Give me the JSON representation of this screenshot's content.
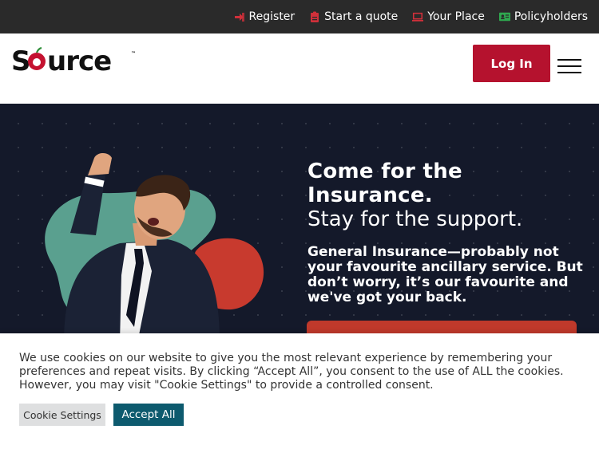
{
  "topbar": {
    "links": [
      {
        "label": "Register",
        "icon": "register-icon"
      },
      {
        "label": "Start a quote",
        "icon": "clipboard-icon"
      },
      {
        "label": "Your Place",
        "icon": "laptop-icon"
      },
      {
        "label": "Policyholders",
        "icon": "id-card-icon"
      }
    ]
  },
  "header": {
    "logo_text": "Source",
    "login_label": "Log In"
  },
  "hero": {
    "title_line1": "Come for the",
    "title_line2": "Insurance.",
    "subtitle": "Stay for the support.",
    "body": "General Insurance—probably not your favourite ancillary service. But don’t worry, it’s our favourite and we've got your back."
  },
  "cookie": {
    "text": "We use cookies on our website to give you the most relevant experience by remembering your preferences and repeat visits. By clicking “Accept All”, you consent to the use of ALL the cookies. However, you may visit \"Cookie Settings\" to provide a controlled consent.",
    "settings_label": "Cookie Settings",
    "accept_label": "Accept All"
  },
  "colors": {
    "brand_red": "#b5122e",
    "topbar_bg": "#2a2a2a",
    "hero_bg": "#14192a",
    "accept_teal": "#0d5a6e",
    "icon_red": "#d0303a",
    "icon_green": "#2fa84f"
  }
}
